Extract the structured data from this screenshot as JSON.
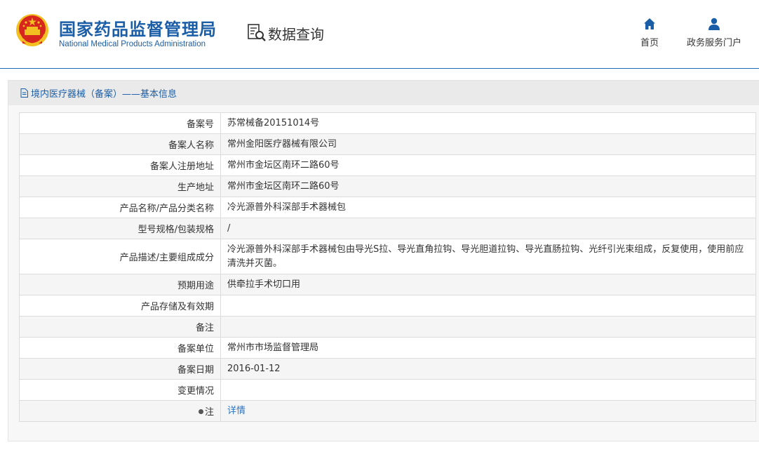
{
  "header": {
    "org_name_zh": "国家药品监督管理局",
    "org_name_en": "National Medical Products Administration",
    "query_label": "数据查询",
    "nav": [
      {
        "label": "首页",
        "icon": "home-icon"
      },
      {
        "label": "政务服务门户",
        "icon": "user-icon"
      }
    ]
  },
  "panel": {
    "title": "境内医疗器械（备案）——基本信息",
    "rows": [
      {
        "label": "备案号",
        "value": "苏常械备20151014号"
      },
      {
        "label": "备案人名称",
        "value": "常州金阳医疗器械有限公司"
      },
      {
        "label": "备案人注册地址",
        "value": "常州市金坛区南环二路60号"
      },
      {
        "label": "生产地址",
        "value": "常州市金坛区南环二路60号"
      },
      {
        "label": "产品名称/产品分类名称",
        "value": "冷光源普外科深部手术器械包"
      },
      {
        "label": "型号规格/包装规格",
        "value": "/"
      },
      {
        "label": "产品描述/主要组成成分",
        "value": "冷光源普外科深部手术器械包由导光S拉、导光直角拉钩、导光胆道拉钩、导光直肠拉钩、光纤引光束组成，反复使用，使用前应清洗并灭菌。"
      },
      {
        "label": "预期用途",
        "value": "供牵拉手术切口用"
      },
      {
        "label": "产品存储及有效期",
        "value": ""
      },
      {
        "label": "备注",
        "value": ""
      },
      {
        "label": "备案单位",
        "value": "常州市市场监督管理局"
      },
      {
        "label": "备案日期",
        "value": "2016-01-12"
      },
      {
        "label": "变更情况",
        "value": ""
      }
    ],
    "note": {
      "label": "注",
      "link_text": "详情"
    }
  },
  "colors": {
    "brand_blue": "#1b5ea8",
    "link_blue": "#2a74c2",
    "emblem_red": "#d7261e",
    "emblem_gold": "#f2c020"
  }
}
